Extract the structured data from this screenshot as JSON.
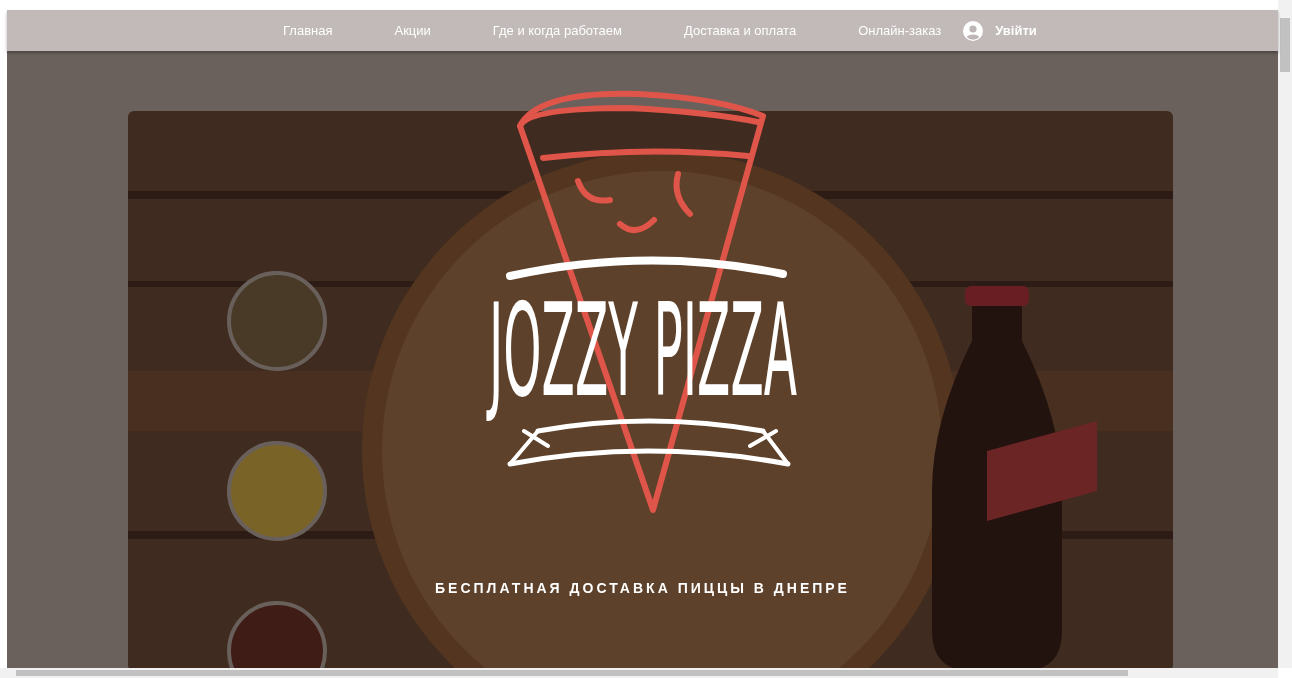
{
  "nav": {
    "items": [
      {
        "label": "Главная"
      },
      {
        "label": "Акции"
      },
      {
        "label": "Где и когда работаем"
      },
      {
        "label": "Доставка и оплата"
      },
      {
        "label": "Онлайн-заказ"
      }
    ],
    "login": {
      "label": "Увійти"
    }
  },
  "hero": {
    "logo": "JOZZY PIZZA",
    "tagline": "БЕСПЛАТНАЯ ДОСТАВКА ПИЦЦЫ В ДНЕПРЕ"
  }
}
